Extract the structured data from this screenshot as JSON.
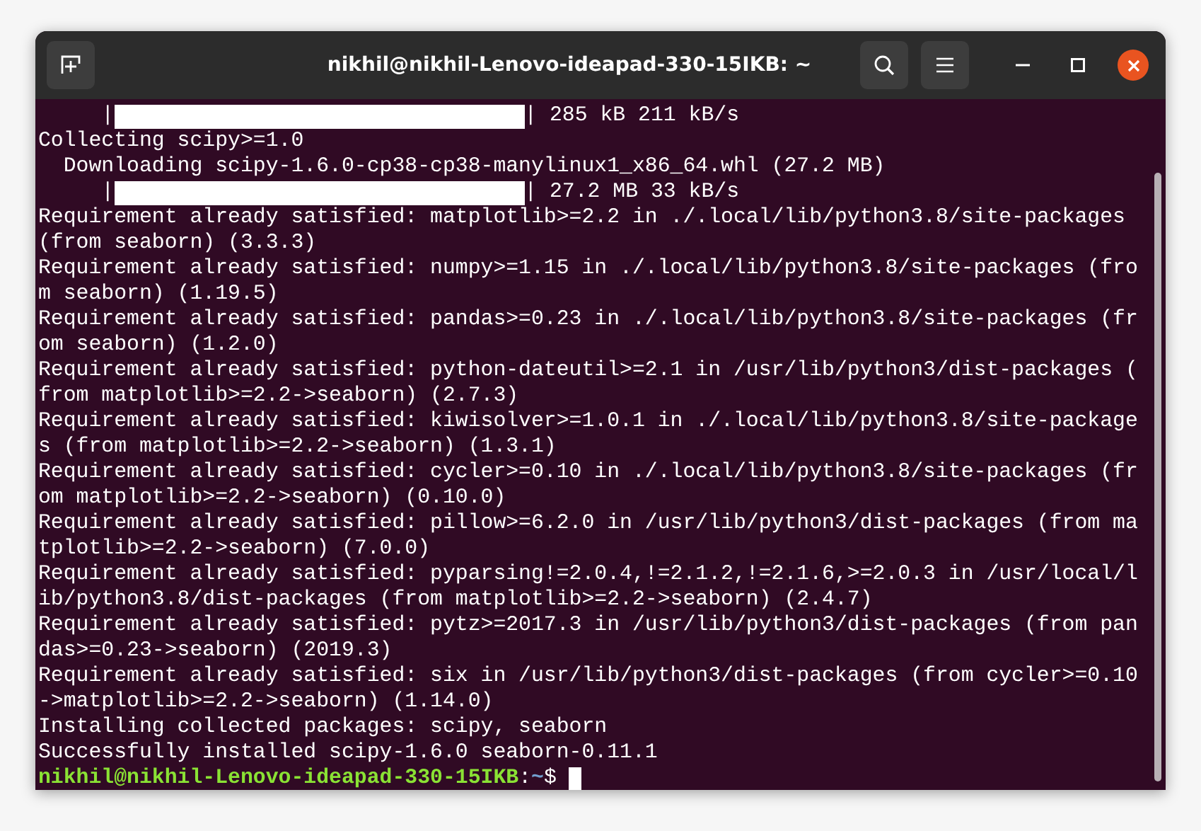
{
  "window": {
    "title": "nikhil@nikhil-Lenovo-ideapad-330-15IKB: ~"
  },
  "terminal": {
    "lines": [
      {
        "kind": "progress",
        "prefix": "     |",
        "level": 1,
        "suffix": "| 285 kB 211 kB/s"
      },
      {
        "kind": "text",
        "text": "Collecting scipy>=1.0"
      },
      {
        "kind": "text",
        "text": "  Downloading scipy-1.6.0-cp38-cp38-manylinux1_x86_64.whl (27.2 MB)"
      },
      {
        "kind": "progress",
        "prefix": "     |",
        "level": 1,
        "suffix": "| 27.2 MB 33 kB/s"
      },
      {
        "kind": "text",
        "text": "Requirement already satisfied: matplotlib>=2.2 in ./.local/lib/python3.8/site-packages"
      },
      {
        "kind": "text",
        "text": "(from seaborn) (3.3.3)"
      },
      {
        "kind": "text",
        "text": "Requirement already satisfied: numpy>=1.15 in ./.local/lib/python3.8/site-packages (fro"
      },
      {
        "kind": "text",
        "text": "m seaborn) (1.19.5)"
      },
      {
        "kind": "text",
        "text": "Requirement already satisfied: pandas>=0.23 in ./.local/lib/python3.8/site-packages (fr"
      },
      {
        "kind": "text",
        "text": "om seaborn) (1.2.0)"
      },
      {
        "kind": "text",
        "text": "Requirement already satisfied: python-dateutil>=2.1 in /usr/lib/python3/dist-packages ("
      },
      {
        "kind": "text",
        "text": "from matplotlib>=2.2->seaborn) (2.7.3)"
      },
      {
        "kind": "text",
        "text": "Requirement already satisfied: kiwisolver>=1.0.1 in ./.local/lib/python3.8/site-package"
      },
      {
        "kind": "text",
        "text": "s (from matplotlib>=2.2->seaborn) (1.3.1)"
      },
      {
        "kind": "text",
        "text": "Requirement already satisfied: cycler>=0.10 in ./.local/lib/python3.8/site-packages (fr"
      },
      {
        "kind": "text",
        "text": "om matplotlib>=2.2->seaborn) (0.10.0)"
      },
      {
        "kind": "text",
        "text": "Requirement already satisfied: pillow>=6.2.0 in /usr/lib/python3/dist-packages (from ma"
      },
      {
        "kind": "text",
        "text": "tplotlib>=2.2->seaborn) (7.0.0)"
      },
      {
        "kind": "text",
        "text": "Requirement already satisfied: pyparsing!=2.0.4,!=2.1.2,!=2.1.6,>=2.0.3 in /usr/local/l"
      },
      {
        "kind": "text",
        "text": "ib/python3.8/dist-packages (from matplotlib>=2.2->seaborn) (2.4.7)"
      },
      {
        "kind": "text",
        "text": "Requirement already satisfied: pytz>=2017.3 in /usr/lib/python3/dist-packages (from pan"
      },
      {
        "kind": "text",
        "text": "das>=0.23->seaborn) (2019.3)"
      },
      {
        "kind": "text",
        "text": "Requirement already satisfied: six in /usr/lib/python3/dist-packages (from cycler>=0.10"
      },
      {
        "kind": "text",
        "text": "->matplotlib>=2.2->seaborn) (1.14.0)"
      },
      {
        "kind": "text",
        "text": "Installing collected packages: scipy, seaborn"
      },
      {
        "kind": "text",
        "text": "Successfully installed scipy-1.6.0 seaborn-0.11.1"
      },
      {
        "kind": "prompt",
        "user": "nikhil@nikhil-Lenovo-ideapad-330-15IKB",
        "separator": ":",
        "path": "~",
        "sign": "$"
      }
    ]
  }
}
